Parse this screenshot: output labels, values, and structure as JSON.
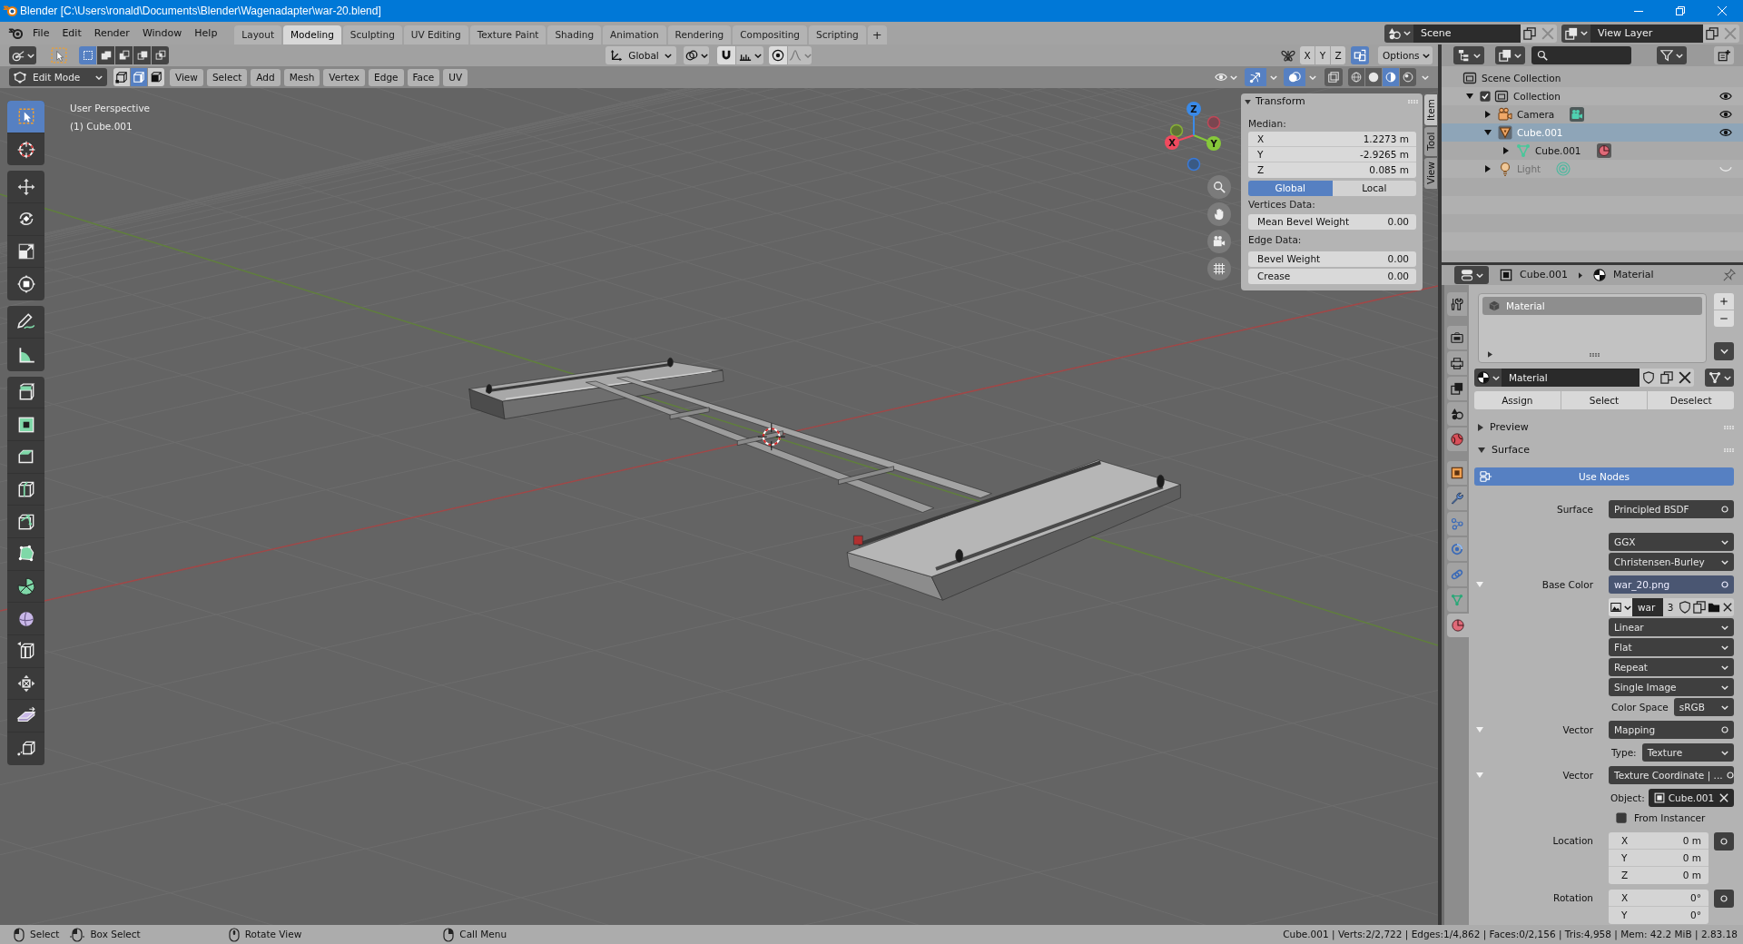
{
  "window": {
    "title": "Blender [C:\\Users\\ronald\\Documents\\Blender\\Wagenadapter\\war-20.blend]"
  },
  "topbar": {
    "menus": [
      "File",
      "Edit",
      "Render",
      "Window",
      "Help"
    ],
    "workspaces": [
      {
        "label": "Layout",
        "selected": false
      },
      {
        "label": "Modeling",
        "selected": true
      },
      {
        "label": "Sculpting",
        "selected": false
      },
      {
        "label": "UV Editing",
        "selected": false
      },
      {
        "label": "Texture Paint",
        "selected": false
      },
      {
        "label": "Shading",
        "selected": false
      },
      {
        "label": "Animation",
        "selected": false
      },
      {
        "label": "Rendering",
        "selected": false
      },
      {
        "label": "Compositing",
        "selected": false
      },
      {
        "label": "Scripting",
        "selected": false
      }
    ],
    "add_workspace": "+",
    "scene": "Scene",
    "view_layer": "View Layer"
  },
  "tool_header": {
    "select_modes": [
      {
        "kind": "set",
        "selected": true
      },
      {
        "kind": "extend",
        "selected": false
      },
      {
        "kind": "subtract",
        "selected": false
      },
      {
        "kind": "invert",
        "selected": false
      },
      {
        "kind": "intersect",
        "selected": false
      }
    ],
    "orientation": "Global",
    "mirror_axes": [
      {
        "label": "X",
        "selected": false
      },
      {
        "label": "Y",
        "selected": false
      },
      {
        "label": "Z",
        "selected": false
      }
    ],
    "auto_merge": true,
    "options": "Options"
  },
  "view_header": {
    "mode": "Edit Mode",
    "mesh_select_modes": [
      {
        "kind": "vertex",
        "selected": false
      },
      {
        "kind": "edge",
        "selected": true
      },
      {
        "kind": "face",
        "selected": false
      }
    ],
    "menus": [
      "View",
      "Select",
      "Add",
      "Mesh",
      "Vertex",
      "Edge",
      "Face",
      "UV"
    ],
    "gizmos": true,
    "overlays": true,
    "xray": false,
    "shading": [
      {
        "kind": "wireframe",
        "selected": false
      },
      {
        "kind": "solid",
        "selected": false
      },
      {
        "kind": "material",
        "selected": true
      },
      {
        "kind": "rendered",
        "selected": false
      }
    ]
  },
  "viewport": {
    "info": [
      "User Perspective",
      "(1) Cube.001"
    ],
    "gizmo_axes": [
      "X",
      "Y",
      "Z"
    ],
    "toolbar": [
      {
        "tools": [
          {
            "kind": "select_box",
            "selected": true
          },
          {
            "kind": "cursor",
            "selected": false
          }
        ]
      },
      {
        "tools": [
          {
            "kind": "move",
            "selected": false
          },
          {
            "kind": "rotate",
            "selected": false
          },
          {
            "kind": "scale",
            "selected": false
          },
          {
            "kind": "transform",
            "selected": false
          }
        ]
      },
      {
        "tools": [
          {
            "kind": "annotate",
            "selected": false
          },
          {
            "kind": "measure",
            "selected": false
          }
        ]
      },
      {
        "tools": [
          {
            "kind": "extrude",
            "selected": false
          },
          {
            "kind": "inset",
            "selected": false
          },
          {
            "kind": "bevel",
            "selected": false
          },
          {
            "kind": "loop_cut",
            "selected": false
          },
          {
            "kind": "knife",
            "selected": false
          },
          {
            "kind": "poly_build",
            "selected": false
          },
          {
            "kind": "spin",
            "selected": false
          },
          {
            "kind": "smooth",
            "selected": false
          },
          {
            "kind": "edge_slide",
            "selected": false
          },
          {
            "kind": "shrink_fatten",
            "selected": false
          },
          {
            "kind": "shear",
            "selected": false
          },
          {
            "kind": "rip",
            "selected": false
          }
        ]
      }
    ]
  },
  "sidebar": {
    "tabs": [
      {
        "label": "Item",
        "selected": true
      },
      {
        "label": "Tool",
        "selected": false
      },
      {
        "label": "View",
        "selected": false
      }
    ],
    "panel": {
      "title": "Transform",
      "expanded": true,
      "median_label": "Median:",
      "median": [
        {
          "axis": "X",
          "value": "1.2273 m"
        },
        {
          "axis": "Y",
          "value": "-2.9265 m"
        },
        {
          "axis": "Z",
          "value": "0.085 m"
        }
      ],
      "space": [
        {
          "label": "Global",
          "selected": true
        },
        {
          "label": "Local",
          "selected": false
        }
      ],
      "vertices_label": "Vertices Data:",
      "vertices": [
        {
          "label": "Mean Bevel Weight",
          "value": "0.00"
        }
      ],
      "edges_label": "Edge Data:",
      "edges": [
        {
          "label": "Bevel Weight",
          "value": "0.00"
        },
        {
          "label": "Crease",
          "value": "0.00"
        }
      ]
    }
  },
  "outliner": {
    "root": {
      "label": "Scene Collection",
      "children": [
        {
          "label": "Collection",
          "kind": "collection",
          "checked": true,
          "expanded": true,
          "visible": true,
          "children": [
            {
              "label": "Camera",
              "kind": "camera",
              "expanded": false,
              "selected": false,
              "visible": true
            },
            {
              "label": "Cube.001",
              "kind": "mesh_object",
              "expanded": true,
              "selected": true,
              "visible": true,
              "children": [
                {
                  "label": "Cube.001",
                  "kind": "mesh_data",
                  "expanded": false
                }
              ]
            },
            {
              "label": "Light",
              "kind": "light",
              "expanded": false,
              "selected": false,
              "visible": false
            }
          ]
        }
      ]
    }
  },
  "properties": {
    "breadcrumb": [
      {
        "kind": "object",
        "label": "Cube.001"
      },
      {
        "kind": "material",
        "label": "Material"
      }
    ],
    "tab_groups": [
      {
        "tabs": [
          {
            "kind": "tool",
            "selected": false
          }
        ]
      },
      {
        "tabs": [
          {
            "kind": "render",
            "selected": false
          },
          {
            "kind": "output",
            "selected": false
          },
          {
            "kind": "view_layer",
            "selected": false
          },
          {
            "kind": "scene",
            "selected": false
          },
          {
            "kind": "world",
            "selected": false
          }
        ]
      },
      {
        "tabs": [
          {
            "kind": "object",
            "selected": false
          },
          {
            "kind": "modifiers",
            "selected": false
          },
          {
            "kind": "particles",
            "selected": false
          },
          {
            "kind": "physics",
            "selected": false
          },
          {
            "kind": "constraints",
            "selected": false
          },
          {
            "kind": "data",
            "selected": false
          },
          {
            "kind": "material",
            "selected": true
          }
        ]
      }
    ],
    "slots": [
      {
        "label": "Material",
        "selected": true
      }
    ],
    "material": "Material",
    "slot_actions": [
      "Assign",
      "Select",
      "Deselect"
    ],
    "panels": [
      {
        "title": "Preview",
        "expanded": false
      },
      {
        "title": "Surface",
        "expanded": true
      }
    ],
    "use_nodes": {
      "label": "Use Nodes",
      "on": true
    },
    "rows": [
      {
        "kind": "node",
        "label": "Surface",
        "value": "Principled BSDF"
      },
      {
        "kind": "enum",
        "value": "GGX"
      },
      {
        "kind": "enum",
        "value": "Christensen-Burley"
      },
      {
        "kind": "link",
        "label": "Base Color",
        "value": "war_20.png",
        "expanded": true,
        "highlighted": true
      },
      {
        "kind": "image",
        "name": "war",
        "users": "3"
      },
      {
        "kind": "enum",
        "value": "Linear"
      },
      {
        "kind": "enum",
        "value": "Flat"
      },
      {
        "kind": "enum",
        "value": "Repeat"
      },
      {
        "kind": "enum",
        "value": "Single Image"
      },
      {
        "kind": "enum",
        "label": "Color Space",
        "value": "sRGB"
      },
      {
        "kind": "link",
        "label": "Vector",
        "value": "Mapping",
        "expanded": true,
        "highlighted": false
      },
      {
        "kind": "enum",
        "label": "Type:",
        "value": "Texture"
      },
      {
        "kind": "link",
        "label": "Vector",
        "value": "Texture Coordinate | ...",
        "expanded": true,
        "highlighted": false
      },
      {
        "kind": "object",
        "label": "Object:",
        "value": "Cube.001"
      },
      {
        "kind": "checkbox",
        "label": "From Instancer",
        "checked": false
      },
      {
        "kind": "vector",
        "label": "Location",
        "values": [
          {
            "axis": "X",
            "value": "0 m"
          },
          {
            "axis": "Y",
            "value": "0 m"
          },
          {
            "axis": "Z",
            "value": "0 m"
          }
        ]
      },
      {
        "kind": "vector",
        "label": "Rotation",
        "values": [
          {
            "axis": "X",
            "value": "0°"
          },
          {
            "axis": "Y",
            "value": "0°"
          }
        ]
      }
    ]
  },
  "status_bar": {
    "hints": [
      {
        "kind": "left_click",
        "label": "Select"
      },
      {
        "kind": "left_drag",
        "label": "Box Select"
      },
      {
        "kind": "middle_click",
        "label": "Rotate View"
      },
      {
        "kind": "right_click",
        "label": "Call Menu"
      }
    ],
    "stats": "Cube.001 | Verts:2/2,722 | Edges:1/4,862 | Faces:0/2,156 | Tris:4,958 | Mem: 42.2 MiB | 2.83.18"
  }
}
